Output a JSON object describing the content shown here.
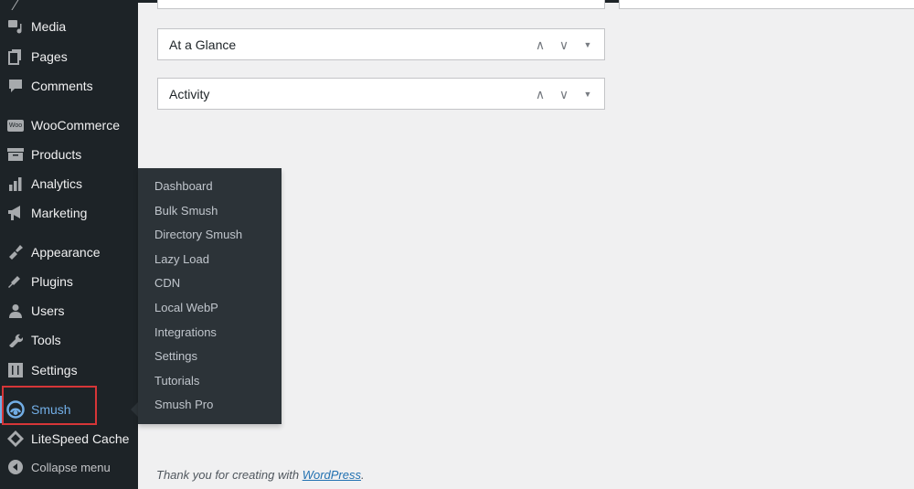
{
  "sidebar": {
    "items": [
      {
        "label": "Media",
        "icon": "media-icon"
      },
      {
        "label": "Pages",
        "icon": "pages-icon"
      },
      {
        "label": "Comments",
        "icon": "comments-icon"
      },
      {
        "label": "WooCommerce",
        "icon": "woo-icon"
      },
      {
        "label": "Products",
        "icon": "products-icon"
      },
      {
        "label": "Analytics",
        "icon": "analytics-icon"
      },
      {
        "label": "Marketing",
        "icon": "megaphone-icon"
      },
      {
        "label": "Appearance",
        "icon": "paintbrush-icon"
      },
      {
        "label": "Plugins",
        "icon": "plugin-icon"
      },
      {
        "label": "Users",
        "icon": "user-icon"
      },
      {
        "label": "Tools",
        "icon": "wrench-icon"
      },
      {
        "label": "Settings",
        "icon": "settings-icon"
      },
      {
        "label": "Smush",
        "icon": "smush-icon"
      },
      {
        "label": "LiteSpeed Cache",
        "icon": "litespeed-icon"
      }
    ],
    "collapse": "Collapse menu",
    "woo_badge": "Woo"
  },
  "flyout": {
    "items": [
      "Dashboard",
      "Bulk Smush",
      "Directory Smush",
      "Lazy Load",
      "CDN",
      "Local WebP",
      "Integrations",
      "Settings",
      "Tutorials",
      "Smush Pro"
    ]
  },
  "widgets": [
    {
      "title": "At a Glance"
    },
    {
      "title": "Activity"
    }
  ],
  "controls": {
    "up": "∧",
    "down": "∨",
    "toggle": "▼"
  },
  "footer": {
    "text": "Thank you for creating with ",
    "link": "WordPress",
    "end": "."
  },
  "colors": {
    "sidebar": "#1d2327",
    "flyout": "#2c3338",
    "accent": "#72aee6",
    "highlight": "#d63638"
  }
}
